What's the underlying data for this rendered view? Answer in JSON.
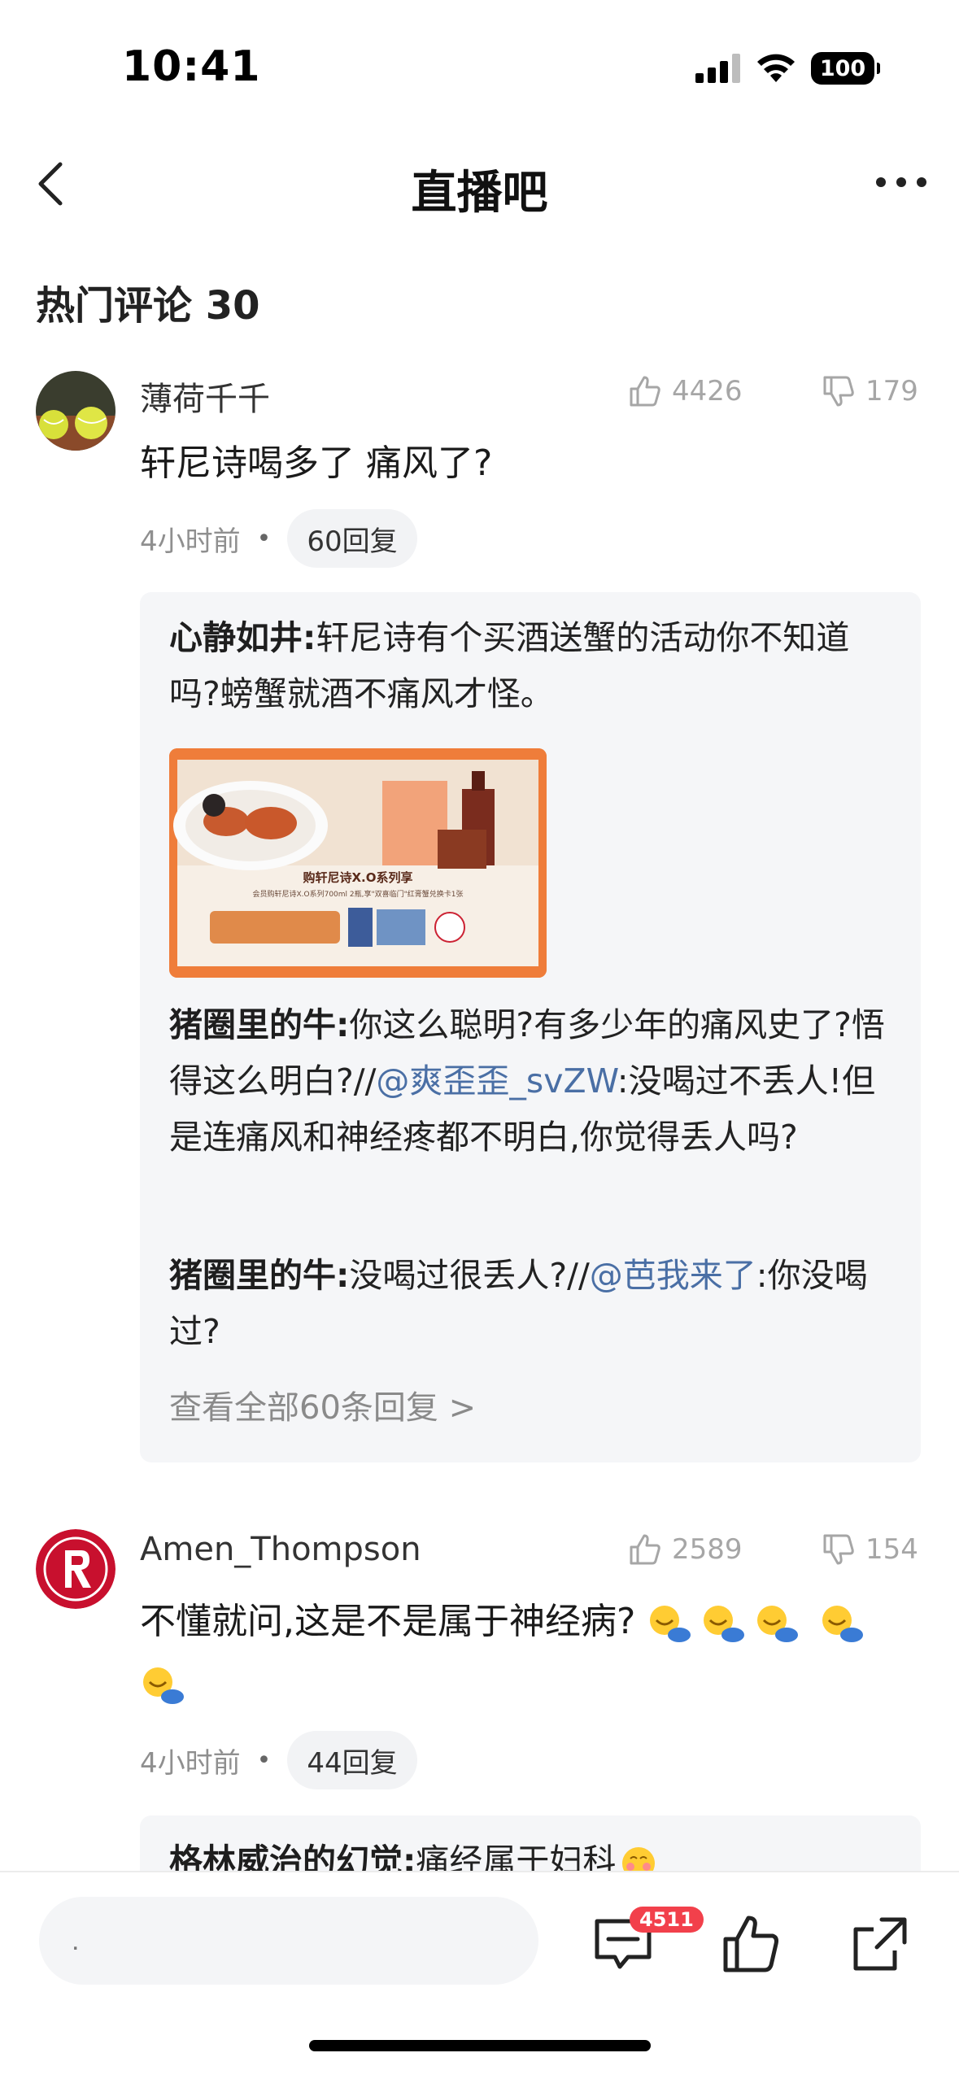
{
  "status_bar": {
    "time": "10:41",
    "battery": "100"
  },
  "nav": {
    "title": "直播吧"
  },
  "section": {
    "title": "热门评论 30"
  },
  "comments": [
    {
      "username": "薄荷千千",
      "likes": "4426",
      "dislikes": "179",
      "text": "轩尼诗喝多了 痛风了?",
      "time": "4小时前",
      "reply_count": "60回复",
      "replies": [
        {
          "author": "心静如井:",
          "text": "轩尼诗有个买酒送蟹的活动你不知道吗?螃蟹就酒不痛风才怪。"
        },
        {
          "author": "猪圈里的牛:",
          "text_before": "你这么聪明?有多少年的痛风史了?悟得这么明白?//",
          "mention": "@爽歪歪_svZW",
          "text_after": ":没喝过不丢人!但是连痛风和神经疼都不明白,你觉得丢人吗?"
        },
        {
          "author": "猪圈里的牛:",
          "text_before": "没喝过很丢人?//",
          "mention": "@芭我来了",
          "text_after": ":你没喝过?"
        }
      ],
      "image": {
        "headline": "购轩尼诗X.O系列享",
        "subline": "会员购轩尼诗X.O系列700ml 2瓶,享\"双喜临门\"红膏蟹兑换卡1张"
      },
      "view_all": "查看全部60条回复 >"
    },
    {
      "username": "Amen_Thompson",
      "likes": "2589",
      "dislikes": "154",
      "text": "不懂就问,这是不是属于神经病?",
      "time": "4小时前",
      "reply_count": "44回复",
      "replies": [
        {
          "author": "格林威治的幻觉:",
          "text": "痛经属于妇科"
        }
      ]
    }
  ],
  "bottom_bar": {
    "input_placeholder": ".",
    "comment_badge": "4511"
  },
  "colors": {
    "mention": "#4a6fa5",
    "badge": "#f2404b",
    "reply_bg": "#f5f6f8"
  }
}
